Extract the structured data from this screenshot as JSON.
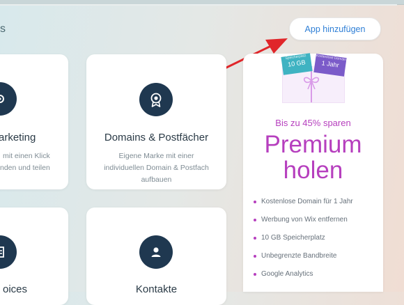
{
  "header": {
    "title_fragment": "s",
    "add_app_label": "App hinzufügen"
  },
  "cards": {
    "marketing": {
      "title": "arketing",
      "desc_line1": "mit einen Klick",
      "desc_line2": "nden und teilen"
    },
    "domains": {
      "title": "Domains & Postfächer",
      "desc_line1": "Eigene Marke mit einer",
      "desc_line2": "individuellen Domain & Postfach",
      "desc_line3": "aufbauen"
    },
    "invoices": {
      "title": "oices"
    },
    "contacts": {
      "title": "Kontakte"
    }
  },
  "premium": {
    "tag_left_small": "Speicherplatz",
    "tag_left_value": "10 GB",
    "tag_right_small": "Kostenlose Domain",
    "tag_right_value": "1 Jahr",
    "subtitle": "Bis zu 45% sparen",
    "title_line1": "Premium",
    "title_line2": "holen",
    "features": [
      "Kostenlose Domain für 1 Jahr",
      "Werbung von Wix entfernen",
      "10 GB Speicherplatz",
      "Unbegrenzte Bandbreite",
      "Google Analytics"
    ]
  },
  "colors": {
    "accent_blue": "#2f7fd6",
    "premium_purple": "#b63fbe",
    "icon_navy": "#1f3850",
    "arrow_red": "#e0262a"
  }
}
